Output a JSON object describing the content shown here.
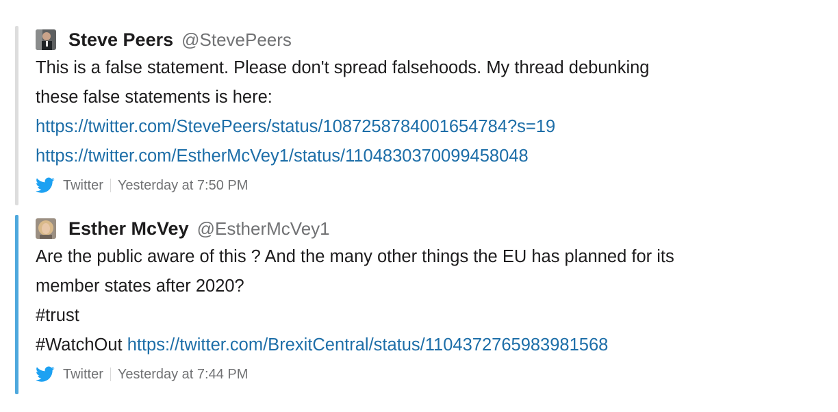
{
  "attachments": [
    {
      "author": {
        "name": "Steve Peers",
        "handle": "@StevePeers"
      },
      "text_lines": [
        "This is a false statement. Please don't spread falsehoods. My thread debunking",
        "these false statements is here:"
      ],
      "links": [
        "https://twitter.com/StevePeers/status/1087258784001654784?s=19",
        "https://twitter.com/EstherMcVey1/status/1104830370099458048"
      ],
      "footer": {
        "source": "Twitter",
        "timestamp": "Yesterday at 7:50 PM"
      },
      "bar_color": "#dddddd"
    },
    {
      "author": {
        "name": "Esther McVey",
        "handle": "@EstherMcVey1"
      },
      "text_lines": [
        "Are the public aware of this ? And the many other things the EU has planned for its",
        "member states after 2020?",
        "#trust"
      ],
      "last_line": {
        "prefix": "#WatchOut",
        "link": "https://twitter.com/BrexitCentral/status/1104372765983981568"
      },
      "footer": {
        "source": "Twitter",
        "timestamp": "Yesterday at 7:44 PM"
      },
      "bar_color": "#4ea8dd"
    }
  ],
  "colors": {
    "link": "#1d6ea8",
    "twitter_blue": "#1da1f2",
    "muted": "#717274"
  },
  "icons": [
    "twitter-bird-icon",
    "avatar"
  ]
}
